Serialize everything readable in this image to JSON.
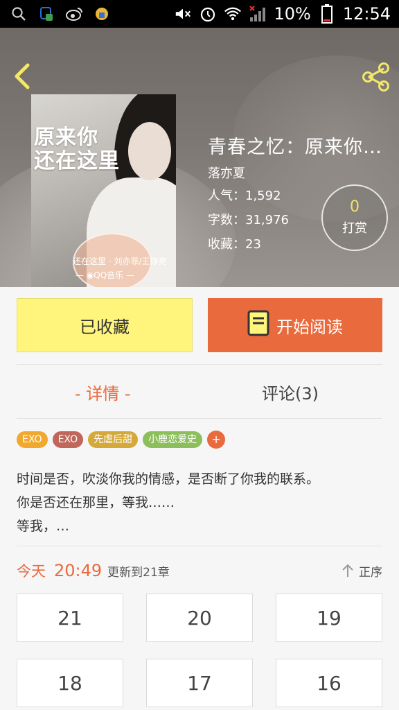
{
  "status_bar": {
    "battery": "10%",
    "time": "12:54"
  },
  "book": {
    "title": "青春之忆：原来你…",
    "author": "落亦夏",
    "popularity": "人气：1,592",
    "word_count": "字数：31,976",
    "favorites": "收藏：23",
    "cover": {
      "title_line1": "原来你",
      "title_line2": "还在这里",
      "subtitle": "还在这里 · 刘亦菲/王铮亮",
      "music": "— ◉QQ音乐 —"
    }
  },
  "reward": {
    "count": "0",
    "label": "打赏"
  },
  "actions": {
    "favorited_label": "已收藏",
    "start_reading_label": "开始阅读"
  },
  "tabs": {
    "detail": "- 详情 -",
    "comments": "评论(3)"
  },
  "tags": [
    {
      "label": "EXO",
      "color": "#f0a92e"
    },
    {
      "label": "EXO",
      "color": "#c0665a"
    },
    {
      "label": "先虐后甜",
      "color": "#d4a93a"
    },
    {
      "label": "小鹿恋爱史",
      "color": "#8cbf5c"
    }
  ],
  "tag_more": "+",
  "description": {
    "line1": "时间是否，吹淡你我的情感，是否断了你我的联系。",
    "line2": "你是否还在那里，等我……",
    "line3": "等我，…"
  },
  "update": {
    "today": "今天",
    "time": "20:49",
    "chapter_text": "更新到21章",
    "sort_label": "正序"
  },
  "chapters": [
    "21",
    "20",
    "19",
    "18",
    "17",
    "16"
  ],
  "colors": {
    "accent": "#e96a3c",
    "favorite_bg": "#fff57c",
    "reward_num": "#f5e16b"
  }
}
